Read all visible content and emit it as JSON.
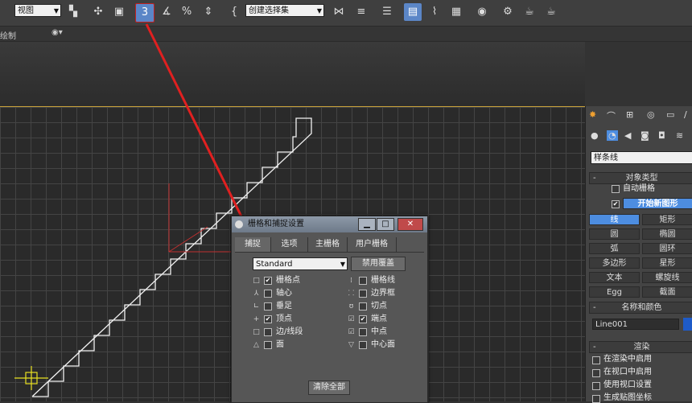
{
  "toolbar": {
    "view_select": "视图",
    "snap_label": "3",
    "named_selection": "创建选择集"
  },
  "subbar": {
    "label": "绘制"
  },
  "dialog": {
    "title": "栅格和捕捉设置",
    "tabs": [
      "捕捉",
      "选项",
      "主栅格",
      "用户栅格"
    ],
    "preset": "Standard",
    "override_button": "禁用覆盖",
    "clear_button": "清除全部",
    "left_items": [
      {
        "label": "栅格点",
        "checked": true
      },
      {
        "label": "轴心",
        "checked": false
      },
      {
        "label": "垂足",
        "checked": false
      },
      {
        "label": "顶点",
        "checked": true
      },
      {
        "label": "边/线段",
        "checked": false
      },
      {
        "label": "面",
        "checked": false
      }
    ],
    "right_items": [
      {
        "label": "栅格线",
        "checked": false
      },
      {
        "label": "边界框",
        "checked": false
      },
      {
        "label": "切点",
        "checked": false
      },
      {
        "label": "端点",
        "checked": true
      },
      {
        "label": "中点",
        "checked": false
      },
      {
        "label": "中心面",
        "checked": false
      }
    ]
  },
  "panel": {
    "category": "样条线",
    "object_type_header": "对象类型",
    "auto_grid": "自动栅格",
    "start_new_shape": "开始新图形",
    "buttons": [
      "线",
      "矩形",
      "圆",
      "椭圆",
      "弧",
      "圆环",
      "多边形",
      "星形",
      "文本",
      "螺旋线",
      "Egg",
      "截面"
    ],
    "name_color_header": "名称和颜色",
    "object_name": "Line001",
    "rendering_header": "渲染",
    "render_options": [
      "在渲染中启用",
      "在视口中启用",
      "使用视口设置",
      "生成贴图坐标"
    ]
  },
  "colors": {
    "accent": "#4d8de0",
    "viewport_border": "#c9a23a",
    "annotation": "#e02020"
  }
}
